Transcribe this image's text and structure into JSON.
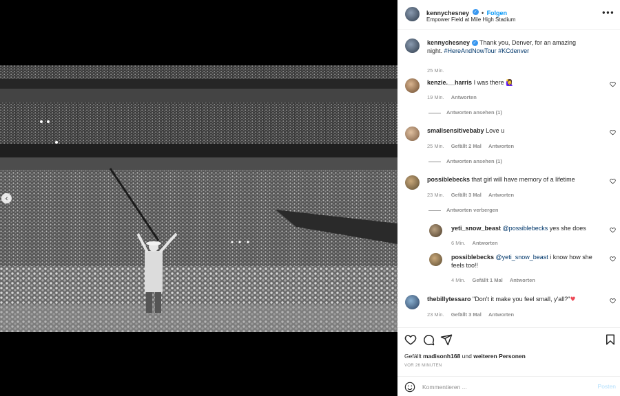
{
  "post": {
    "username": "kennychesney",
    "follow_label": "Folgen",
    "separator": "•",
    "location": "Empower Field at Mile High Stadium",
    "more_label": "•••"
  },
  "caption": {
    "username": "kennychesney",
    "text": "Thank you, Denver, for an amazing night.",
    "hashtags": "#HereAndNowTour #KCdenver",
    "time": "25 Min."
  },
  "comments": [
    {
      "username": "kenzie.__harris",
      "text": "I was there 🙋‍♀️",
      "time": "19 Min.",
      "likes": "",
      "reply_label": "Antworten",
      "view_replies": "Antworten ansehen (1)"
    },
    {
      "username": "smallsensitivebaby",
      "text": "Love u",
      "time": "25 Min.",
      "likes": "Gefällt 2 Mal",
      "reply_label": "Antworten",
      "view_replies": "Antworten ansehen (1)"
    },
    {
      "username": "possiblebecks",
      "text": "that girl will have memory of a lifetime",
      "time": "23 Min.",
      "likes": "Gefällt 3 Mal",
      "reply_label": "Antworten",
      "view_replies": "Antworten verbergen"
    },
    {
      "username": "thebillytessaro",
      "text": "\"Don't it make you feel small, y'all?\"",
      "time": "23 Min.",
      "likes": "Gefällt 3 Mal",
      "reply_label": "Antworten",
      "view_replies": ""
    }
  ],
  "replies": [
    {
      "username": "yeti_snow_beast",
      "mention": "@possiblebecks",
      "text": "yes she does",
      "time": "6 Min.",
      "likes": "",
      "reply_label": "Antworten"
    },
    {
      "username": "possiblebecks",
      "mention": "@yeti_snow_beast",
      "text": "i know how she feels too!!",
      "time": "4 Min.",
      "likes": "Gefällt 1 Mal",
      "reply_label": "Antworten"
    }
  ],
  "footer": {
    "likes_prefix": "Gefällt",
    "liked_by": "madisonh168",
    "likes_mid": "und",
    "likes_others": "weiteren Personen",
    "time_ago": "VOR 26 MINUTEN",
    "comment_placeholder": "Kommentieren ...",
    "post_label": "Posten"
  },
  "colors": {
    "accent": "#0095f6",
    "verified": "#3897f0",
    "heart_red": "#ed4956"
  },
  "icons": [
    "verified-badge-icon",
    "more-options-icon",
    "heart-icon",
    "comment-icon",
    "share-icon",
    "bookmark-icon",
    "emoji-icon",
    "chevron-left-icon"
  ]
}
